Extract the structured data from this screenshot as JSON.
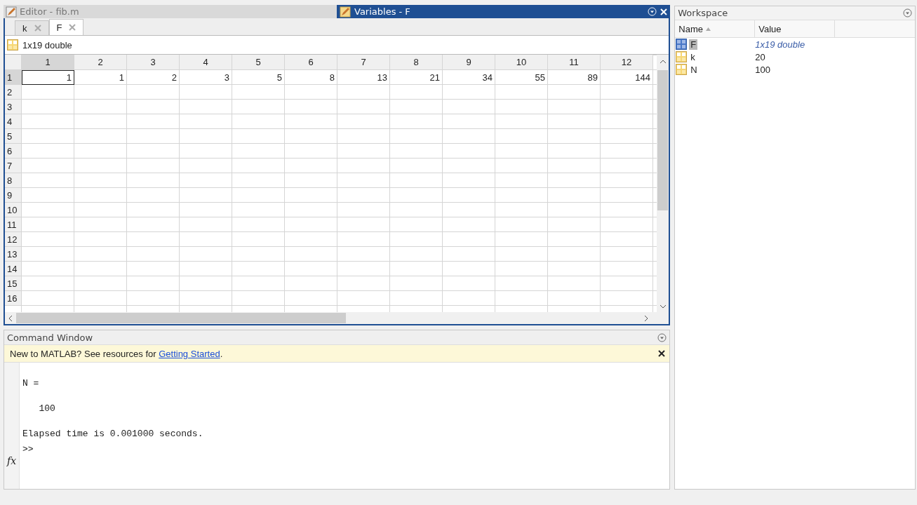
{
  "panels": {
    "editor_title": "Editor - fib.m",
    "variables_title": "Variables - F"
  },
  "variable_tabs": [
    {
      "label": "k",
      "selected": false
    },
    {
      "label": "F",
      "selected": true
    }
  ],
  "variable_info": "1x19 double",
  "table": {
    "columns": [
      {
        "label": "1",
        "selected": true
      },
      {
        "label": "2",
        "selected": false
      },
      {
        "label": "3",
        "selected": false
      },
      {
        "label": "4",
        "selected": false
      },
      {
        "label": "5",
        "selected": false
      },
      {
        "label": "6",
        "selected": false
      },
      {
        "label": "7",
        "selected": false
      },
      {
        "label": "8",
        "selected": false
      },
      {
        "label": "9",
        "selected": false
      },
      {
        "label": "10",
        "selected": false
      },
      {
        "label": "11",
        "selected": false
      },
      {
        "label": "12",
        "selected": false
      }
    ],
    "rows": [
      {
        "label": "1",
        "selected": true,
        "cells": [
          {
            "value": "1",
            "selected": true
          },
          {
            "value": "1",
            "selected": false
          },
          {
            "value": "2",
            "selected": false
          },
          {
            "value": "3",
            "selected": false
          },
          {
            "value": "5",
            "selected": false
          },
          {
            "value": "8",
            "selected": false
          },
          {
            "value": "13",
            "selected": false
          },
          {
            "value": "21",
            "selected": false
          },
          {
            "value": "34",
            "selected": false
          },
          {
            "value": "55",
            "selected": false
          },
          {
            "value": "89",
            "selected": false
          },
          {
            "value": "144",
            "selected": false
          }
        ]
      },
      {
        "label": "2",
        "selected": false
      },
      {
        "label": "3",
        "selected": false
      },
      {
        "label": "4",
        "selected": false
      },
      {
        "label": "5",
        "selected": false
      },
      {
        "label": "6",
        "selected": false
      },
      {
        "label": "7",
        "selected": false
      },
      {
        "label": "8",
        "selected": false
      },
      {
        "label": "9",
        "selected": false
      },
      {
        "label": "10",
        "selected": false
      },
      {
        "label": "11",
        "selected": false
      },
      {
        "label": "12",
        "selected": false
      },
      {
        "label": "13",
        "selected": false
      },
      {
        "label": "14",
        "selected": false
      },
      {
        "label": "15",
        "selected": false
      },
      {
        "label": "16",
        "selected": false
      }
    ]
  },
  "command_window": {
    "title": "Command Window",
    "notice": {
      "text": "New to MATLAB? See resources for ",
      "link": "Getting Started",
      "after": "."
    },
    "lines": [
      "N =",
      "   100",
      "Elapsed time is 0.001000 seconds."
    ],
    "function_button": "fx",
    "prompt": ">>"
  },
  "workspace": {
    "title": "Workspace",
    "columns": [
      "Name",
      "Value"
    ],
    "variables": [
      {
        "name": "F",
        "value": "1x19 double",
        "kind": "matrix",
        "selected": true
      },
      {
        "name": "k",
        "value": "20",
        "kind": "scalar",
        "selected": false
      },
      {
        "name": "N",
        "value": "100",
        "kind": "scalar",
        "selected": false
      }
    ]
  }
}
